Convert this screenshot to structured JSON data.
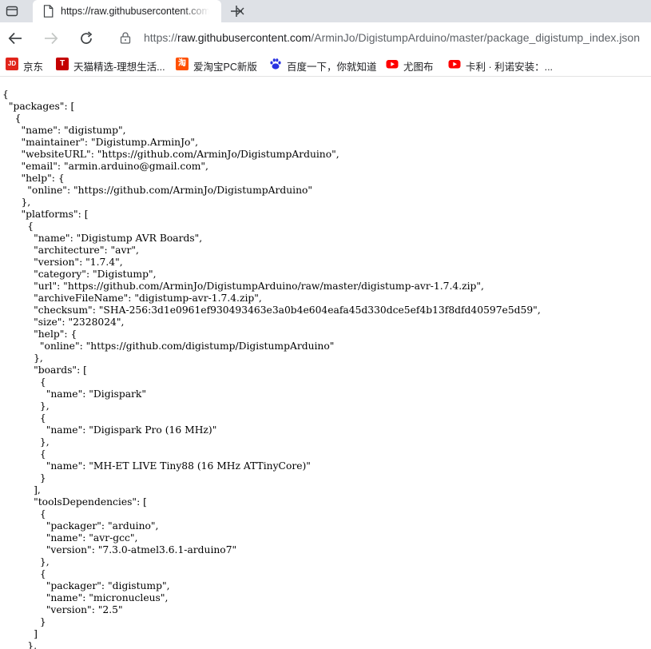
{
  "tab": {
    "title": "https://raw.githubusercontent.com/ArminJo/DigistumpArduino/master/package_digistump_index.json",
    "favicon": "document-icon"
  },
  "toolbar": {
    "url_scheme": "https://",
    "url_host": "raw.githubusercontent.com",
    "url_path": "/ArminJo/DigistumpArduino/master/package_digistump_index.json"
  },
  "bookmarks": [
    {
      "label": "京东",
      "icon": "jd-logo",
      "color": "#e1251b",
      "glyph": "JD"
    },
    {
      "label": "天猫精选-理想生活...",
      "icon": "tmall-logo",
      "color": "#c40000",
      "glyph": "T"
    },
    {
      "label": "爱淘宝PC新版",
      "icon": "taobao-logo",
      "color": "#ff5000",
      "glyph": "淘"
    },
    {
      "label": "百度一下，你就知道",
      "icon": "baidu-paw-logo",
      "color": "#2932e1",
      "glyph": ""
    },
    {
      "label": "尤图布",
      "icon": "youtube-logo",
      "color": "#ff0000",
      "glyph": ""
    },
    {
      "label": "卡利 · 利诺安装：...",
      "icon": "youtube-logo",
      "color": "#ff0000",
      "glyph": ""
    }
  ],
  "json_lines": [
    "{",
    "  \"packages\": [",
    "    {",
    "      \"name\": \"digistump\",",
    "      \"maintainer\": \"Digistump.ArminJo\",",
    "      \"websiteURL\": \"https://github.com/ArminJo/DigistumpArduino\",",
    "      \"email\": \"armin.arduino@gmail.com\",",
    "      \"help\": {",
    "        \"online\": \"https://github.com/ArminJo/DigistumpArduino\"",
    "      },",
    "      \"platforms\": [",
    "        {",
    "          \"name\": \"Digistump AVR Boards\",",
    "          \"architecture\": \"avr\",",
    "          \"version\": \"1.7.4\",",
    "          \"category\": \"Digistump\",",
    "          \"url\": \"https://github.com/ArminJo/DigistumpArduino/raw/master/digistump-avr-1.7.4.zip\",",
    "          \"archiveFileName\": \"digistump-avr-1.7.4.zip\",",
    "          \"checksum\": \"SHA-256:3d1e0961ef930493463e3a0b4e604eafa45d330dce5ef4b13f8dfd40597e5d59\",",
    "          \"size\": \"2328024\",",
    "          \"help\": {",
    "            \"online\": \"https://github.com/digistump/DigistumpArduino\"",
    "          },",
    "          \"boards\": [",
    "            {",
    "              \"name\": \"Digispark\"",
    "            },",
    "            {",
    "              \"name\": \"Digispark Pro (16 MHz)\"",
    "            },",
    "            {",
    "              \"name\": \"MH-ET LIVE Tiny88 (16 MHz ATTinyCore)\"",
    "            }",
    "          ],",
    "          \"toolsDependencies\": [",
    "            {",
    "              \"packager\": \"arduino\",",
    "              \"name\": \"avr-gcc\",",
    "              \"version\": \"7.3.0-atmel3.6.1-arduino7\"",
    "            },",
    "            {",
    "              \"packager\": \"digistump\",",
    "              \"name\": \"micronucleus\",",
    "              \"version\": \"2.5\"",
    "            }",
    "          ]",
    "        },"
  ]
}
